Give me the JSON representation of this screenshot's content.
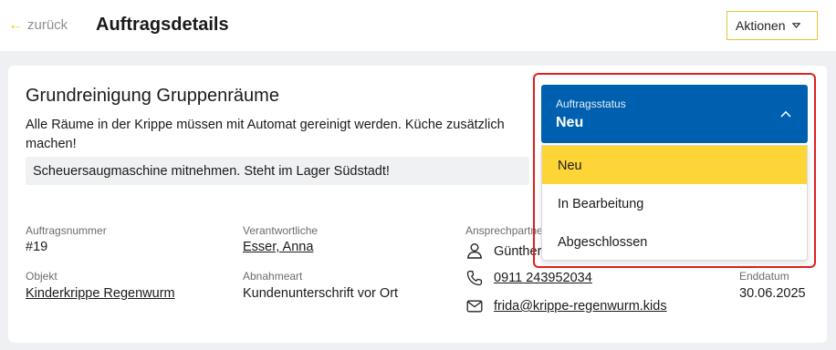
{
  "header": {
    "back_label": "zurück",
    "title": "Auftragsdetails",
    "actions_label": "Aktionen"
  },
  "job": {
    "title": "Grundreinigung Gruppenräume",
    "description": "Alle Räume in der Krippe müssen mit Automat gereinigt werden. Küche zusätzlich machen!",
    "note": "Scheuersaugmaschine mitnehmen. Steht im Lager Südstadt!"
  },
  "details": {
    "order_number_label": "Auftragsnummer",
    "order_number": "#19",
    "responsible_label": "Verantwortliche",
    "responsible": "Esser, Anna",
    "contact_label": "Ansprechpartner",
    "object_label": "Objekt",
    "object": "Kinderkrippe Regenwurm",
    "acceptance_label": "Abnahmeart",
    "acceptance": "Kundenunterschrift vor Ort",
    "end_date_label": "Enddatum",
    "end_date": "30.06.2025"
  },
  "contact": {
    "name": "Günther",
    "phone": "0911 243952034",
    "email": "frida@krippe-regenwurm.kids"
  },
  "status": {
    "label": "Auftragsstatus",
    "current": "Neu",
    "options": [
      "Neu",
      "In Bearbeitung",
      "Abgeschlossen"
    ]
  },
  "colors": {
    "accent_yellow": "#fdd537",
    "status_blue": "#0060b0",
    "highlight_red": "#e02020"
  }
}
